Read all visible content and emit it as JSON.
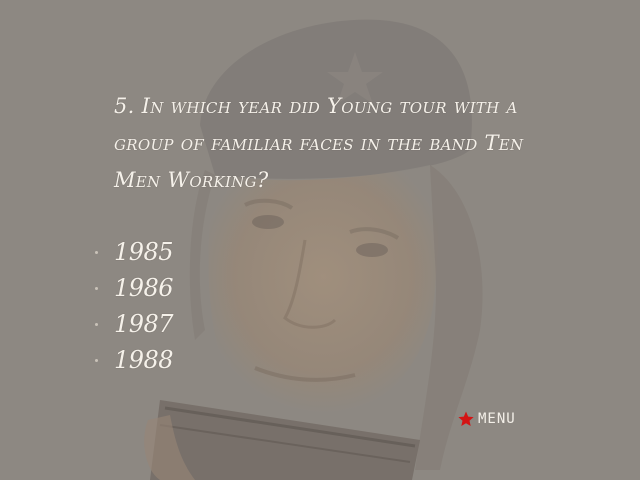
{
  "quiz": {
    "question": "5. In which year did Young tour with a group of familiar faces in the band Ten Men Working?",
    "answers": [
      "1985",
      "1986",
      "1987",
      "1988"
    ]
  },
  "menu": {
    "label": "MENU",
    "icon": "star-icon",
    "icon_color": "#d41414"
  },
  "colors": {
    "background": "#8d8882",
    "text": "#f5f1ea"
  }
}
